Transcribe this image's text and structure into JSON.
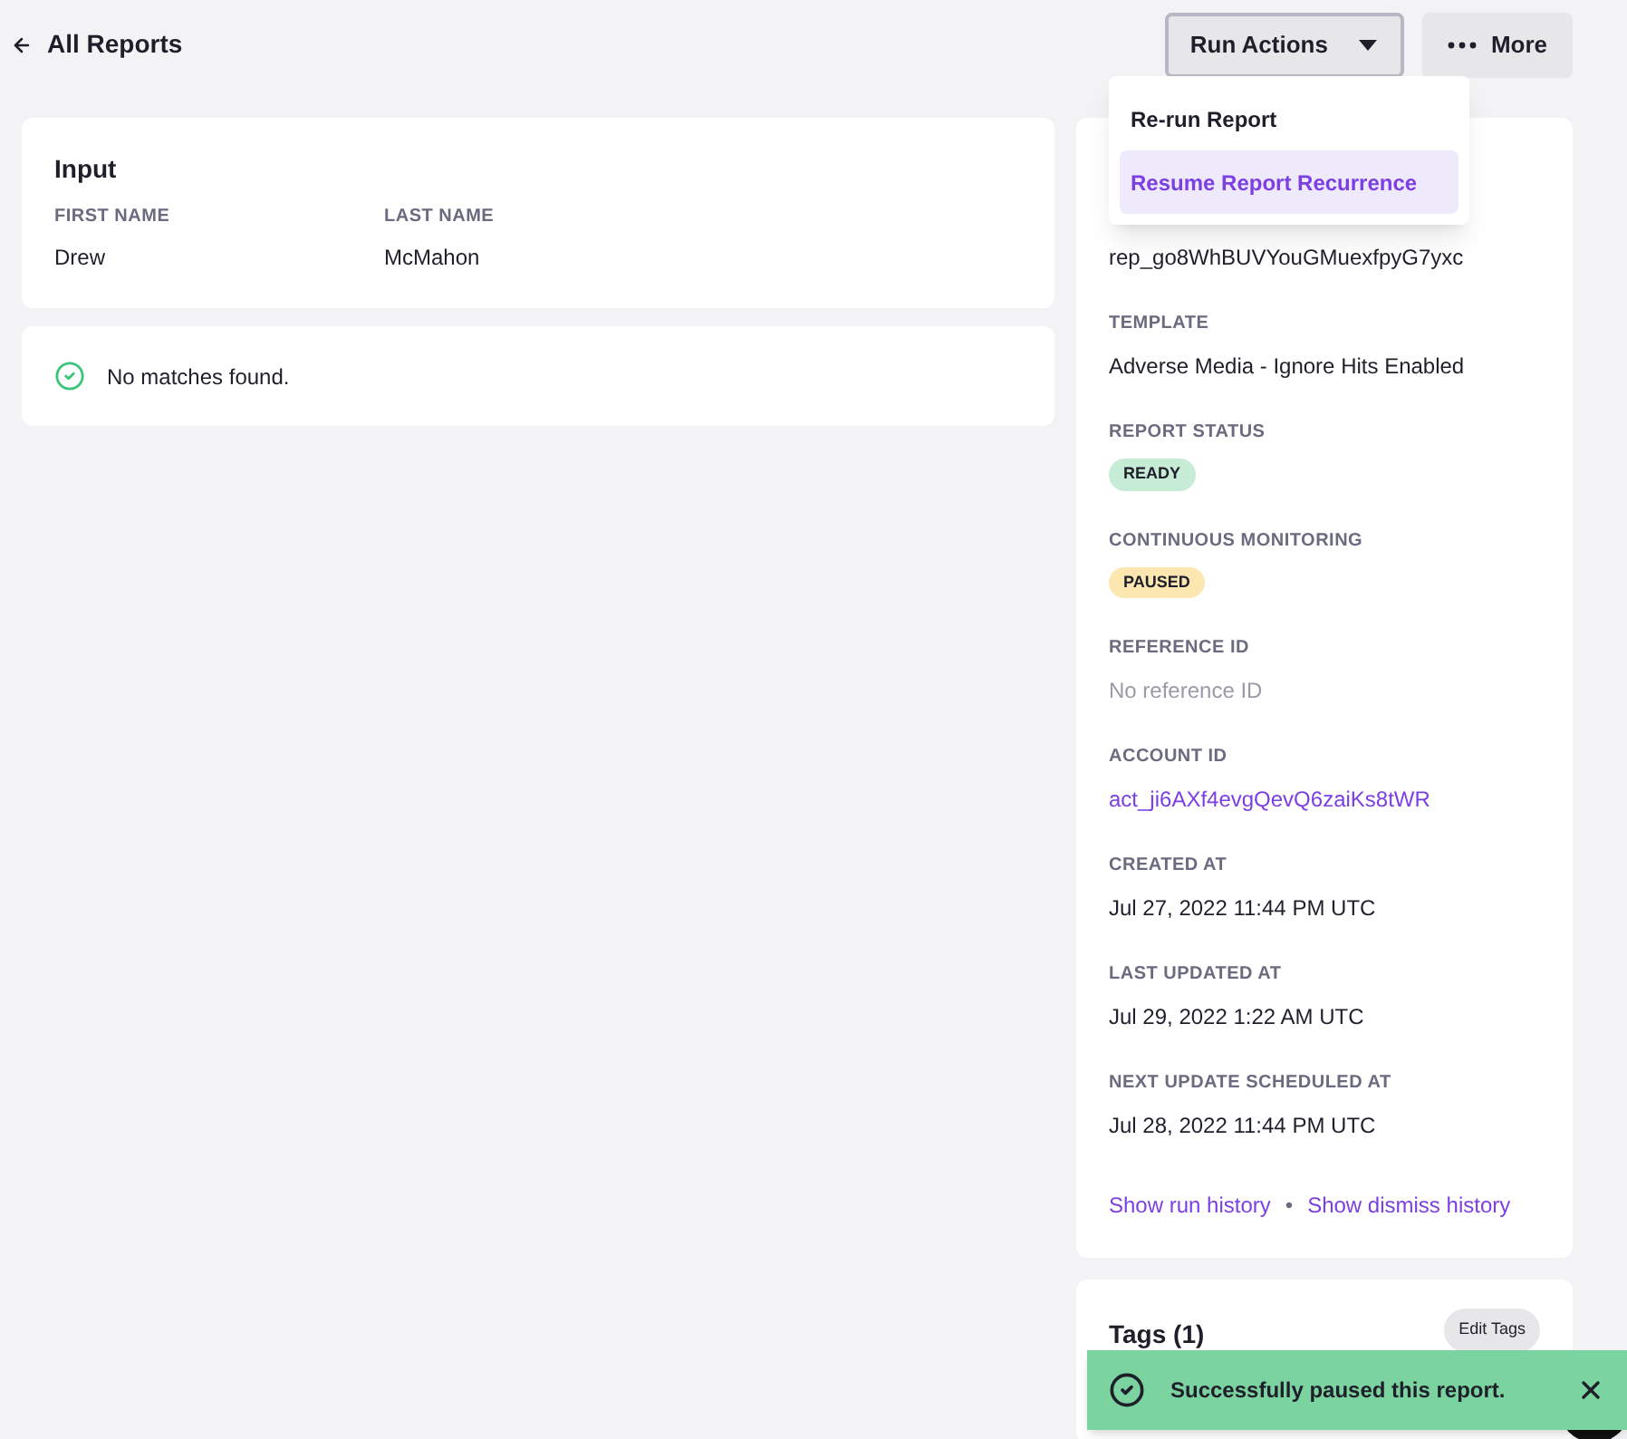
{
  "header": {
    "back_label": "All Reports",
    "buttons": [
      {
        "label": "Run Actions",
        "kind": "dropdown",
        "expanded": true
      },
      {
        "label": "More",
        "kind": "more",
        "expanded": false
      }
    ]
  },
  "menu": {
    "items": [
      {
        "label": "Re-run Report",
        "selected": false
      },
      {
        "label": "Resume Report Recurrence",
        "selected": true
      }
    ]
  },
  "input_card": {
    "title": "Input",
    "fields": [
      {
        "label": "FIRST NAME",
        "value": "Drew"
      },
      {
        "label": "LAST NAME",
        "value": "McMahon"
      }
    ]
  },
  "result": {
    "text": "No matches found."
  },
  "details": {
    "fields": [
      {
        "kind": "text",
        "value": "rep_go8WhBUVYouGMuexfpyG7yxc"
      },
      {
        "kind": "text",
        "label": "TEMPLATE",
        "value": "Adverse Media - Ignore Hits Enabled"
      },
      {
        "kind": "badge",
        "label": "REPORT STATUS",
        "value": "READY",
        "color": "#c6ecd6"
      },
      {
        "kind": "badge",
        "label": "CONTINUOUS MONITORING",
        "value": "PAUSED",
        "color": "#fce7b0"
      },
      {
        "kind": "muted",
        "label": "REFERENCE ID",
        "value": "No reference ID"
      },
      {
        "kind": "link",
        "label": "ACCOUNT ID",
        "value": "act_ji6AXf4evgQevQ6zaiKs8tWR"
      },
      {
        "kind": "text",
        "label": "CREATED AT",
        "value": "Jul 27, 2022 11:44 PM UTC"
      },
      {
        "kind": "text",
        "label": "LAST UPDATED AT",
        "value": "Jul 29, 2022 1:22 AM UTC"
      },
      {
        "kind": "text",
        "label": "NEXT UPDATE SCHEDULED AT",
        "value": "Jul 28, 2022 11:44 PM UTC"
      }
    ],
    "links": [
      "Show run history",
      "Show dismiss history"
    ],
    "separator": "•"
  },
  "tags": {
    "title": "Tags (1)",
    "button": "Edit Tags"
  },
  "toast": {
    "text": "Successfully paused this report."
  }
}
